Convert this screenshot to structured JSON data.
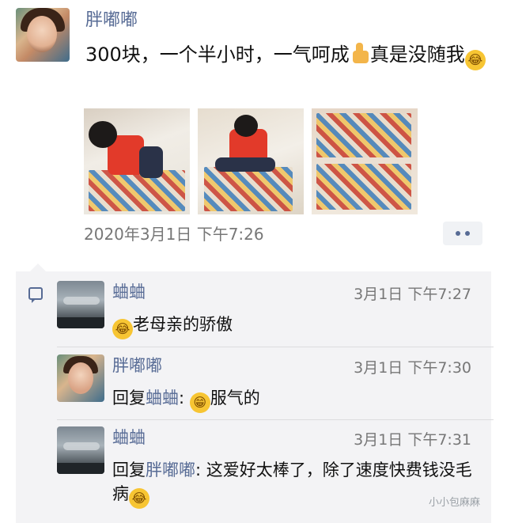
{
  "post": {
    "author": "胖嘟嘟",
    "text_part1": "300块，一个半小时，一气呵成",
    "text_part2": "真是没随我",
    "emoji_thumb": "thumbs-up-emoji",
    "emoji_laugh": "tears-of-joy-emoji",
    "photos": [
      "photo-kid-puzzle-1",
      "photo-kid-puzzle-2",
      "photo-finished-puzzle"
    ],
    "timestamp": "2020年3月1日 下午7:26"
  },
  "comments": [
    {
      "author": "蛐蛐",
      "time": "3月1日 下午7:27",
      "text": "老母亲的骄傲",
      "emoji": "tears-of-joy-emoji"
    },
    {
      "author": "胖嘟嘟",
      "time": "3月1日 下午7:30",
      "reply_prefix": "回复",
      "reply_to": "蛐蛐",
      "colon": ":",
      "text": "服气的",
      "emoji": "grinning-emoji"
    },
    {
      "author": "蛐蛐",
      "time": "3月1日 下午7:31",
      "reply_prefix": "回复",
      "reply_to": "胖嘟嘟",
      "colon": ":",
      "text": "这爱好太棒了，除了速度快费钱没毛病",
      "emoji": "tears-of-joy-emoji"
    }
  ],
  "watermark": "小小包麻麻",
  "colors": {
    "name_blue": "#576b95",
    "comment_bg": "#f3f3f5",
    "time_gray": "#777777"
  }
}
